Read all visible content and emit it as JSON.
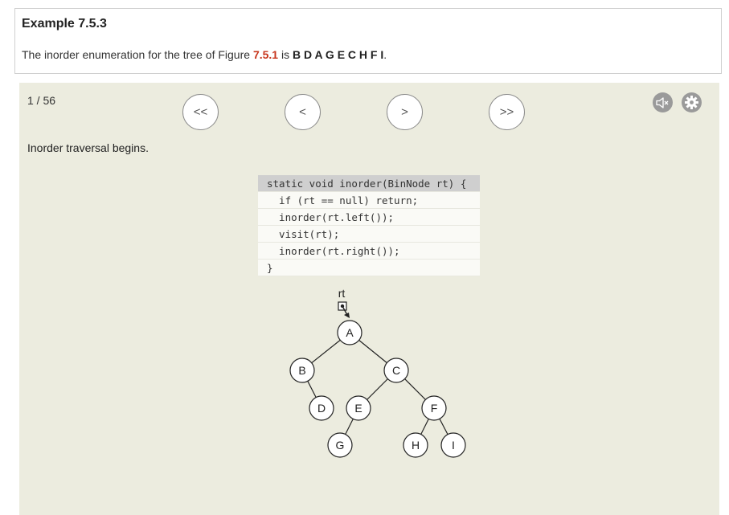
{
  "example": {
    "title": "Example 7.5.3",
    "text_before": "The inorder enumeration for the tree of Figure ",
    "figure_ref": "7.5.1",
    "text_middle": " is ",
    "sequence": "B D A G E C H F I",
    "text_after": "."
  },
  "av": {
    "counter": "1 / 56",
    "buttons": {
      "first": "<<",
      "prev": "<",
      "next": ">",
      "last": ">>"
    },
    "message": "Inorder traversal begins.",
    "code_lines": [
      "static void inorder(BinNode rt) {",
      "  if (rt == null) return;",
      "  inorder(rt.left());",
      "  visit(rt);",
      "  inorder(rt.right());",
      "}"
    ],
    "highlighted_line": 0,
    "pointer_label": "rt",
    "tree_nodes": {
      "A": "A",
      "B": "B",
      "C": "C",
      "D": "D",
      "E": "E",
      "F": "F",
      "G": "G",
      "H": "H",
      "I": "I"
    },
    "colors": {
      "panel_bg": "#ececdf",
      "figure_ref": "#c7341b",
      "highlight": "#cfcfcf"
    }
  }
}
